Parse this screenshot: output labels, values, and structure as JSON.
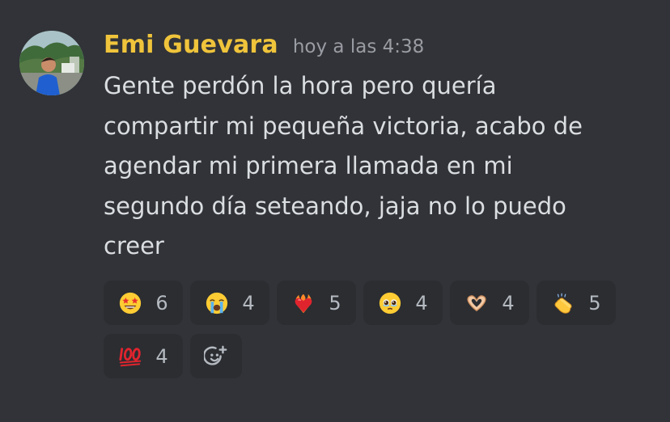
{
  "message": {
    "author": "Emi Guevara",
    "timestamp": "hoy a las 4:38",
    "text": "Gente perdón la hora pero quería\ncompartir mi pequeña victoria, acabo de\nagendar mi primera llamada en mi\nsegundo día seteando, jaja no lo puedo\ncreer",
    "author_color": "#f0c43b"
  },
  "reactions": [
    {
      "emoji": "star-struck-icon",
      "count": "6"
    },
    {
      "emoji": "loudly-crying-face-icon",
      "count": "4"
    },
    {
      "emoji": "heart-on-fire-icon",
      "count": "5"
    },
    {
      "emoji": "face-holding-back-tears-icon",
      "count": "4"
    },
    {
      "emoji": "heart-hands-icon",
      "count": "4"
    },
    {
      "emoji": "clapping-hands-icon",
      "count": "5"
    },
    {
      "emoji": "hundred-points-icon",
      "count": "4"
    }
  ],
  "add_reaction": {
    "icon": "add-reaction-icon"
  }
}
